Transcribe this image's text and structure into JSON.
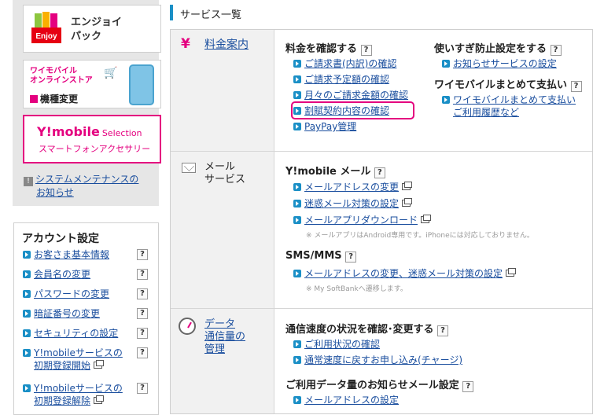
{
  "sidebar": {
    "banners": {
      "enjoy": {
        "badge": "Enjoy",
        "line1": "エンジョイ",
        "line2": "パック"
      },
      "online_store": {
        "line1": "ワイモバイル",
        "line2": "オンラインストア",
        "label": "機種変更"
      },
      "selection": {
        "brand": "Y!mobile",
        "brand_sub": "Selection",
        "sub": "スマートフォンアクセサリー"
      }
    },
    "maintenance": {
      "line1": "システムメンテナンスの",
      "line2": "お知らせ"
    },
    "account": {
      "title": "アカウント設定",
      "items": [
        {
          "label": "お客さま基本情報"
        },
        {
          "label": "会員名の変更"
        },
        {
          "label": "パスワードの変更"
        },
        {
          "label": "暗証番号の変更"
        },
        {
          "label": "セキュリティの設定"
        },
        {
          "label1": "Y!mobileサービスの",
          "label2": "初期登録開始"
        },
        {
          "label1": "Y!mobileサービスの",
          "label2": "初期登録解除"
        }
      ]
    }
  },
  "main": {
    "title": "サービス一覧",
    "help": "?",
    "categories": {
      "billing": {
        "icon": "¥",
        "label": "料金案内"
      },
      "mail": {
        "line1": "メール",
        "line2": "サービス"
      },
      "data": {
        "line1": "データ",
        "line2": "通信量の",
        "line3": "管理"
      }
    },
    "billing": {
      "head": "料金を確認する",
      "links": [
        "ご請求書(内訳)の確認",
        "ご請求予定額の確認",
        "月々のご請求金額の確認",
        "割賦契約内容の確認",
        "PayPay管理"
      ],
      "overuse": {
        "head": "使いすぎ防止設定をする",
        "link": "お知らせサービスの設定"
      },
      "bulk": {
        "head": "ワイモバイルまとめて支払い",
        "link1": "ワイモバイルまとめて支払い",
        "link2": "ご利用履歴など"
      }
    },
    "mail": {
      "head": "Y!mobile メール",
      "links": [
        "メールアドレスの変更",
        "迷惑メール対策の設定",
        "メールアプリダウンロード"
      ],
      "note": "※ メールアプリはAndroid専用です。iPhoneには対応しておりません。",
      "sms_head": "SMS/MMS",
      "sms_link": "メールアドレスの変更、迷惑メール対策の設定",
      "sms_note": "※ My SoftBankへ遷移します。"
    },
    "data": {
      "head": "通信速度の状況を確認･変更する",
      "links": [
        "ご利用状況の確認",
        "通常速度に戻すお申し込み(チャージ)"
      ],
      "notify_head": "ご利用データ量のお知らせメール設定",
      "notify_link": "メールアドレスの設定"
    }
  },
  "colors": {
    "accent": "#e4007f",
    "link": "#1a4e9e",
    "blue": "#1a8fc6"
  }
}
